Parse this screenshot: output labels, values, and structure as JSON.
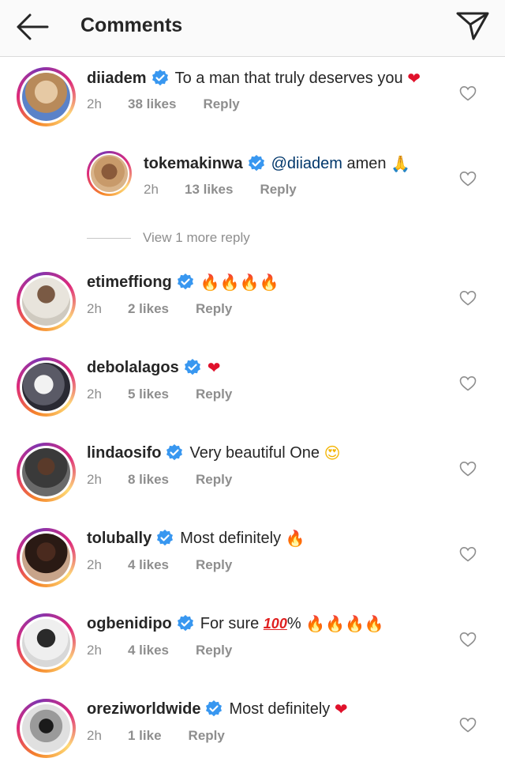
{
  "header": {
    "title": "Comments",
    "back_icon": "back-arrow-icon",
    "share_icon": "paper-plane-icon"
  },
  "comments": [
    {
      "username": "diiadem",
      "text": "To a man that truly deserves you",
      "emoji": "❤",
      "time": "2h",
      "likes": "38 likes",
      "reply": "Reply"
    },
    {
      "username": "tokemakinwa",
      "mention": "@diiadem",
      "text": "amen",
      "emoji": "🙏",
      "time": "2h",
      "likes": "13 likes",
      "reply": "Reply"
    },
    {
      "username": "etimeffiong",
      "emoji": "🔥🔥🔥🔥",
      "time": "2h",
      "likes": "2 likes",
      "reply": "Reply"
    },
    {
      "username": "debolalagos",
      "emoji": "❤",
      "time": "2h",
      "likes": "5 likes",
      "reply": "Reply"
    },
    {
      "username": "lindaosifo",
      "text": "Very beautiful One",
      "emoji": "😍",
      "time": "2h",
      "likes": "8 likes",
      "reply": "Reply"
    },
    {
      "username": "tolubally",
      "text": "Most definitely",
      "emoji": "🔥",
      "time": "2h",
      "likes": "4 likes",
      "reply": "Reply"
    },
    {
      "username": "ogbenidipo",
      "text": "For sure",
      "hundred": "100",
      "suffix": "%",
      "emoji": "🔥🔥🔥🔥",
      "time": "2h",
      "likes": "4 likes",
      "reply": "Reply"
    },
    {
      "username": "oreziworldwide",
      "text": "Most definitely",
      "emoji": "❤",
      "time": "2h",
      "likes": "1 like",
      "reply": "Reply"
    }
  ],
  "view_more_replies": "View 1 more reply",
  "icons": {
    "verified": "verified-badge-icon",
    "like": "heart-outline-icon"
  },
  "colors": {
    "verified": "#3897f0",
    "meta": "#8e8e8e",
    "mention": "#00376b"
  }
}
